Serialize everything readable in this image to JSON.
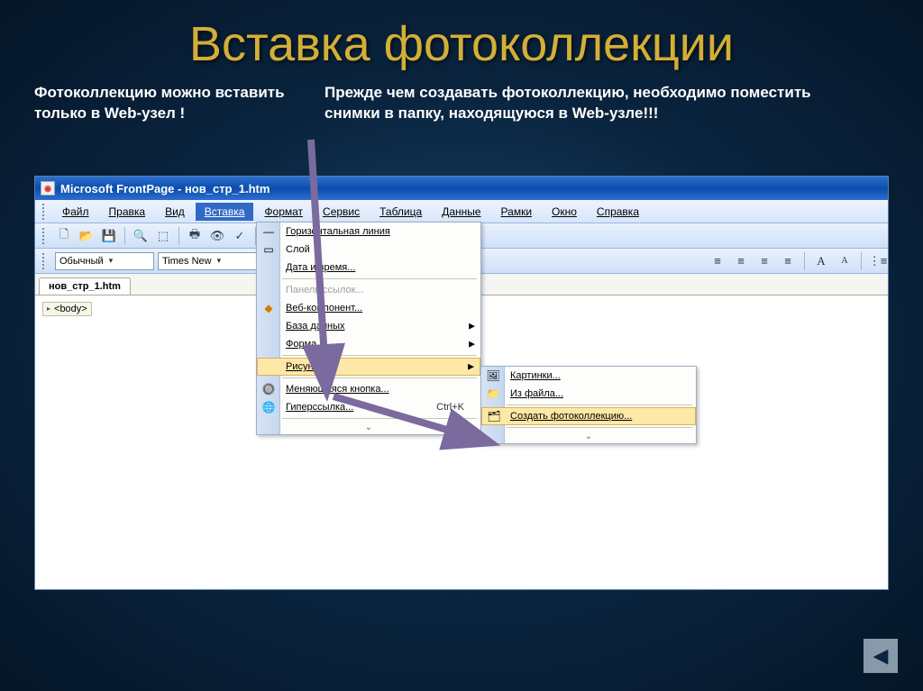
{
  "slide": {
    "title": "Вставка фотоколлекции",
    "caption_left": "Фотоколлекцию можно вставить только в Web-узел !",
    "caption_right": "Прежде чем создавать фотоколлекцию, необходимо поместить снимки в папку, находящуюся в Web-узле!!!"
  },
  "app": {
    "title": "Microsoft FrontPage - нов_стр_1.htm",
    "menubar": [
      "Файл",
      "Правка",
      "Вид",
      "Вставка",
      "Формат",
      "Сервис",
      "Таблица",
      "Данные",
      "Рамки",
      "Окно",
      "Справка"
    ],
    "style_combo": "Обычный",
    "font_combo": "Times New",
    "page_tab": "нов_стр_1.htm",
    "body_tag": "<body>"
  },
  "insert_menu": {
    "items": [
      {
        "label": "Горизонтальная линия",
        "icon": "—",
        "enabled": true
      },
      {
        "label": "Слой",
        "icon": "▭",
        "enabled": true
      },
      {
        "label": "Дата и время...",
        "icon": "",
        "enabled": true
      },
      {
        "label": "Панель ссылок...",
        "icon": "",
        "enabled": false
      },
      {
        "label": "Веб-компонент...",
        "icon": "◆",
        "enabled": true
      },
      {
        "label": "База данных",
        "icon": "",
        "enabled": true,
        "submenu": true
      },
      {
        "label": "Форма",
        "icon": "",
        "enabled": true,
        "submenu": true
      },
      {
        "label": "Рисунок",
        "icon": "",
        "enabled": true,
        "submenu": true,
        "highlighted": true
      },
      {
        "label": "Меняющаяся кнопка...",
        "icon": "🔘",
        "enabled": true
      },
      {
        "label": "Гиперссылка...",
        "icon": "🌐",
        "enabled": true,
        "shortcut": "Ctrl+K"
      }
    ]
  },
  "picture_submenu": {
    "items": [
      {
        "label": "Картинки...",
        "icon": "🖼"
      },
      {
        "label": "Из файла...",
        "icon": "📁"
      },
      {
        "label": "Создать фотоколлекцию...",
        "icon": "🗂",
        "highlighted": true
      }
    ]
  },
  "nav": {
    "back_icon": "◀"
  }
}
